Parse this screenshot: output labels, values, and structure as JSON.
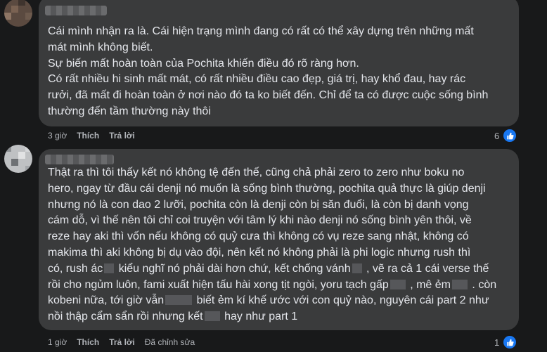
{
  "comments": [
    {
      "lines": [
        "Cái mình nhận ra là. Cái hiện trạng mình đang có rất có thể xây dựng trên những mất",
        "mát mình không biết.",
        "Sự biến mất hoàn toàn của Pochita khiến điều đó rõ ràng hơn.",
        "Có rất nhiều hi sinh mất mát, có rất nhiều điều cao đẹp, giá trị, hay khổ đau, hay rác",
        "rưởi, đã mất đi hoàn toàn ở nơi nào đó ta ko biết đến. Chỉ để ta có được cuộc sống bình",
        "thường đến tầm thường này thôi"
      ],
      "time": "3 giờ",
      "like_label": "Thích",
      "reply_label": "Trả lời",
      "reaction_count": "6"
    },
    {
      "line1": "Thật ra thì tôi thấy kết nó không tệ đến thế, cũng chả phải zero to zero như boku no",
      "line2": "hero, ngay từ đầu cái denji nó muốn là sống bình thường, pochita quả thực là giúp denji",
      "line3": "nhưng nó là con dao 2 lưỡi, pochita còn là denji còn bị săn đuổi, là còn bị danh vọng",
      "line4": "cám dỗ, vì thế nên tôi chỉ coi truyện với tâm lý khi nào denji nó sống bình yên thôi, về",
      "line5": "reze hay aki thì vốn nếu không có quỷ cưa thì không có vụ reze sang nhật, không có",
      "line6": "makima thì aki không bị dụ vào đội, nên kết nó không phải là phi logic nhưng rush thì",
      "line7a": "có, rush ác",
      "line7b": " kiểu nghĩ nó phải dài hơn chứ, kết chống vánh",
      "line7c": " , vẽ ra cả 1 cái verse thế",
      "line8a": "rồi cho ngủm luôn, fami xuất hiện tấu hài xong tịt ngòi, yoru tạch gấp",
      "line8b": " , mê ẻm",
      "line8c": " . còn",
      "line9a": "kobeni nữa, tới giờ vẫn",
      "line9b": " biết ẻm kí khế ước với con quỷ nào, nguyên cái part 2 như",
      "line10a": "nồi thập cẩm sẩn rồi nhưng kết",
      "line10b": " hay như part 1",
      "time": "1 giờ",
      "like_label": "Thích",
      "reply_label": "Trả lời",
      "edited_label": "Đã chỉnh sửa",
      "reaction_count": "1"
    }
  ],
  "colors": {
    "background": "#18191a",
    "bubble": "#3a3b3c",
    "text": "#e4e6eb",
    "meta": "#b0b3b8",
    "like_blue": "#1877f2"
  },
  "icons": {
    "reaction": "thumbs-up-icon"
  }
}
